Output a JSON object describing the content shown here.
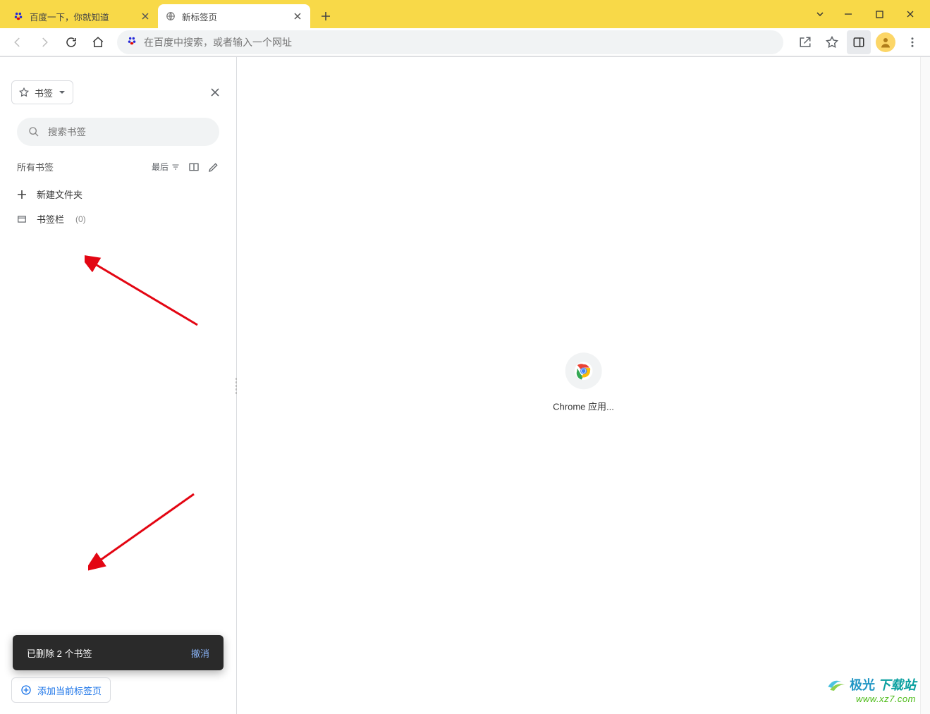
{
  "window": {
    "tabs": [
      {
        "title": "百度一下，你就知道",
        "active": false
      },
      {
        "title": "新标签页",
        "active": true
      }
    ]
  },
  "toolbar": {
    "omnibox_placeholder": "在百度中搜索，或者输入一个网址"
  },
  "bookmarks_panel": {
    "dropdown_label": "书签",
    "search_placeholder": "搜索书签",
    "all_label": "所有书签",
    "sort_label": "最后",
    "new_folder_label": "新建文件夹",
    "bar_label": "书签栏",
    "bar_count": "(0)",
    "add_current_label": "添加当前标签页",
    "toast_message": "已删除 2 个书签",
    "toast_undo": "撤消"
  },
  "main": {
    "app_label": "Chrome 应用..."
  },
  "watermark": {
    "brand_blue": "极光",
    "brand_teal": "下载站",
    "url": "www.xz7.com"
  }
}
